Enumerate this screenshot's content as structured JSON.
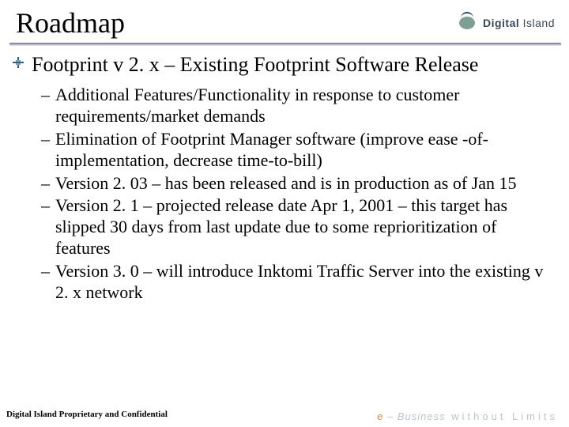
{
  "slide": {
    "title": "Roadmap",
    "brand": {
      "name_bold": "Digital",
      "name_rest": " Island"
    },
    "lvl1": "Footprint v 2. x – Existing Footprint Software Release",
    "bullets": [
      "Additional Features/Functionality in response to customer requirements/market demands",
      "Elimination of Footprint Manager software (improve ease -of-implementation, decrease time-to-bill)",
      "Version 2. 03 – has been released and is in production as of Jan 15",
      "Version 2. 1 – projected release date Apr 1, 2001 – this target has slipped 30 days from last update due to some reprioritization of features",
      "Version 3. 0 – will introduce Inktomi Traffic Server into the existing v 2. x network"
    ],
    "footer_left": "Digital Island Proprietary and Confidential",
    "footer_right": {
      "accent": "e",
      "dash": " – ",
      "word1": "Business",
      "sep": " without ",
      "word2": "Limits"
    }
  }
}
